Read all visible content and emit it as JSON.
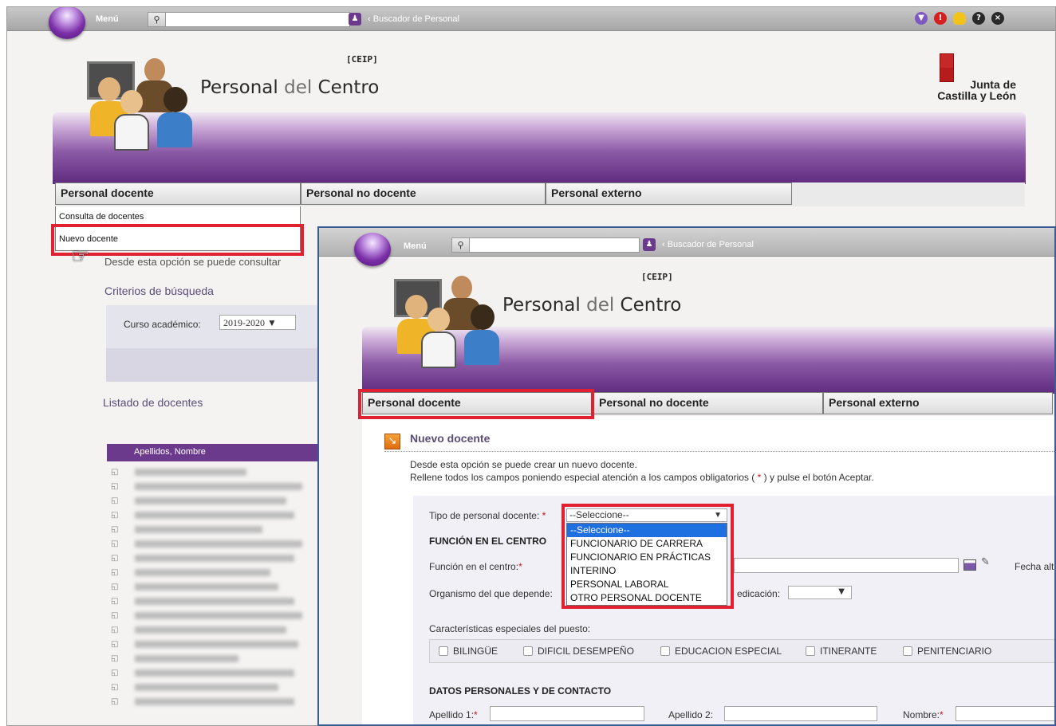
{
  "top_bar": {
    "menu_label": "Menú",
    "crumb_label": "‹ Buscador de Personal"
  },
  "header": {
    "center_code": "[CEIP]",
    "title_part1": "Personal ",
    "title_part2": "del ",
    "title_part3": "Centro",
    "org_line1": "Junta de",
    "org_line2": "Castilla y León"
  },
  "tabs": [
    {
      "label": "Personal docente"
    },
    {
      "label": "Personal no docente"
    },
    {
      "label": "Personal externo"
    }
  ],
  "back_window": {
    "submenu": [
      "Consulta de docentes",
      "Nuevo docente"
    ],
    "partial_desc": "Desde esta opción se puede consultar",
    "search_criteria_title": "Criterios de búsqueda",
    "course_label": "Curso académico:",
    "course_value": "2019-2020",
    "list_title": "Listado de docentes",
    "list_header": "Apellidos, Nombre"
  },
  "form": {
    "section_title": "Nuevo docente",
    "desc_line1": "Desde esta opción se puede crear un nuevo docente.",
    "desc_line2_a": "Rellene todos los campos poniendo especial atención a los campos obligatorios (",
    "required_mark": " * ",
    "desc_line2_b": ") y pulse el botón Aceptar.",
    "tipo_label": "Tipo de personal docente:",
    "tipo_selected": "--Seleccione--",
    "tipo_options": [
      "--Seleccione--",
      "FUNCIONARIO DE CARRERA",
      "FUNCIONARIO EN PRÁCTICAS",
      "INTERINO",
      "PERSONAL LABORAL",
      "OTRO PERSONAL DOCENTE"
    ],
    "funcion_header": "FUNCIÓN EN EL CENTRO",
    "funcion_label": "Función en el centro:",
    "fecha_label": "Fecha alt",
    "organismo_label": "Organismo del que depende:",
    "dedicacion_label": "edicación:",
    "caracteristicas_label": "Características especiales del puesto:",
    "checkboxes": [
      "BILINGÜE",
      "DIFICIL DESEMPEÑO",
      "EDUCACION ESPECIAL",
      "ITINERANTE",
      "PENITENCIARIO"
    ],
    "datos_header": "DATOS PERSONALES Y DE CONTACTO",
    "apellido1_label": "Apellido 1:",
    "apellido2_label": "Apellido 2:",
    "nombre_label": "Nombre:"
  },
  "colors": {
    "highlight": "#e12131",
    "purple": "#6b3a8c",
    "frame": "#3b5d93"
  },
  "icons": [
    "search-icon",
    "user-icon",
    "download-icon",
    "alert-icon",
    "lightbulb-icon",
    "help-icon",
    "close-icon",
    "calendar-icon",
    "edit-icon",
    "section-arrow-icon",
    "hand-cursor-icon",
    "avatar-group-icon",
    "coat-of-arms-icon"
  ]
}
